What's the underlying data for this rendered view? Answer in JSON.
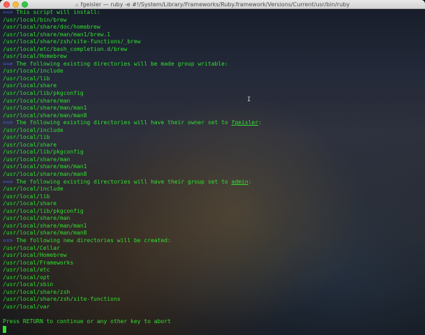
{
  "window": {
    "title": "fgeisler — ruby -e #!/System/Library/Frameworks/Ruby.framework/Versions/Current/usr/bin/ruby"
  },
  "terminal": {
    "prompt_glyph": "==>",
    "sections": [
      {
        "heading": "This script will install:",
        "items": [
          "/usr/local/bin/brew",
          "/usr/local/share/doc/homebrew",
          "/usr/local/share/man/man1/brew.1",
          "/usr/local/share/zsh/site-functions/_brew",
          "/usr/local/etc/bash_completion.d/brew",
          "/usr/local/Homebrew"
        ]
      },
      {
        "heading": "The following existing directories will be made group writable:",
        "items": [
          "/usr/local/include",
          "/usr/local/lib",
          "/usr/local/share",
          "/usr/local/lib/pkgconfig",
          "/usr/local/share/man",
          "/usr/local/share/man/man1",
          "/usr/local/share/man/man8"
        ]
      },
      {
        "heading_prefix": "The following existing directories will have their owner set to ",
        "heading_underlined": "fgeisler",
        "heading_suffix": ":",
        "items": [
          "/usr/local/include",
          "/usr/local/lib",
          "/usr/local/share",
          "/usr/local/lib/pkgconfig",
          "/usr/local/share/man",
          "/usr/local/share/man/man1",
          "/usr/local/share/man/man8"
        ]
      },
      {
        "heading_prefix": "The following existing directories will have their group set to ",
        "heading_underlined": "admin",
        "heading_suffix": ":",
        "items": [
          "/usr/local/include",
          "/usr/local/lib",
          "/usr/local/share",
          "/usr/local/lib/pkgconfig",
          "/usr/local/share/man",
          "/usr/local/share/man/man1",
          "/usr/local/share/man/man8"
        ]
      },
      {
        "heading": "The following new directories will be created:",
        "items": [
          "/usr/local/Cellar",
          "/usr/local/Homebrew",
          "/usr/local/Frameworks",
          "/usr/local/etc",
          "/usr/local/opt",
          "/usr/local/sbin",
          "/usr/local/share/zsh",
          "/usr/local/share/zsh/site-functions",
          "/usr/local/var"
        ]
      }
    ],
    "final_prompt": "Press RETURN to continue or any other key to abort"
  },
  "colors": {
    "text": "#31e02f",
    "prompt": "#4d63e6",
    "titlebar": "#dcdcdc"
  }
}
